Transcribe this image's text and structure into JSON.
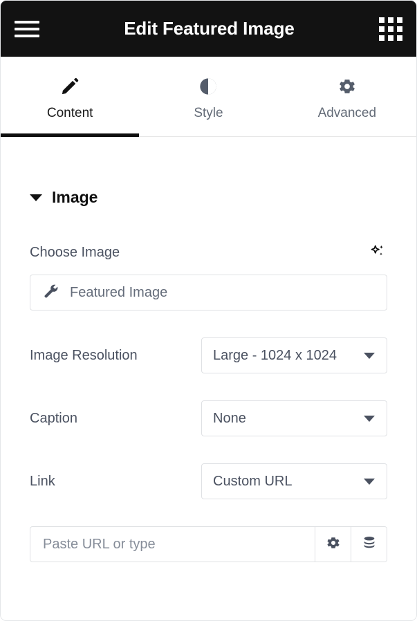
{
  "header": {
    "title": "Edit Featured Image",
    "menu_icon": "hamburger-menu-icon",
    "apps_icon": "grid-apps-icon"
  },
  "tabs": [
    {
      "label": "Content",
      "icon": "pencil-icon",
      "active": true
    },
    {
      "label": "Style",
      "icon": "contrast-icon",
      "active": false
    },
    {
      "label": "Advanced",
      "icon": "gear-icon",
      "active": false
    }
  ],
  "section": {
    "title": "Image",
    "collapse_icon": "caret-down-icon"
  },
  "fields": {
    "choose_image": {
      "label": "Choose Image",
      "ai_icon": "sparkles-ai-icon",
      "media_icon": "wrench-icon",
      "value": "Featured Image"
    },
    "image_resolution": {
      "label": "Image Resolution",
      "value": "Large - 1024 x 1024"
    },
    "caption": {
      "label": "Caption",
      "value": "None"
    },
    "link": {
      "label": "Link",
      "value": "Custom URL"
    },
    "url": {
      "placeholder": "Paste URL or type",
      "value": "",
      "options_icon": "gear-icon",
      "dynamic_icon": "database-icon"
    }
  },
  "colors": {
    "header_bg": "#121212",
    "accent_underline": "#0f0f0f",
    "label_text": "#4a5160",
    "muted_text": "#636b77",
    "border": "#dfe1e4"
  }
}
